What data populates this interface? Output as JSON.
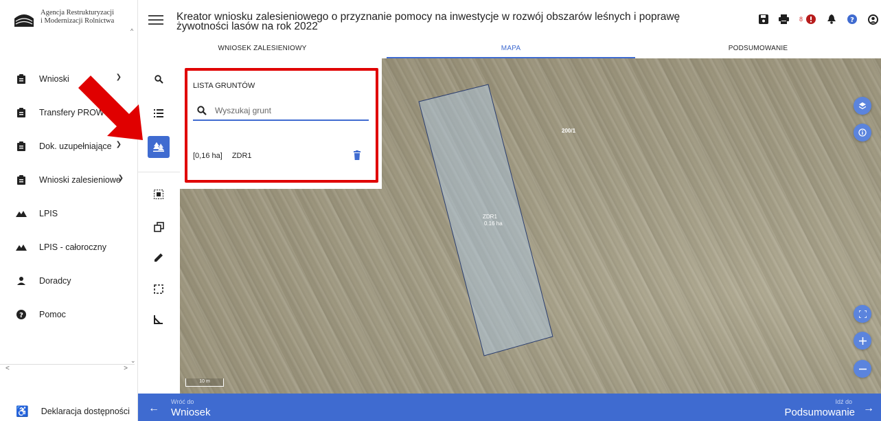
{
  "app": {
    "logo_line1": "Agencja Restrukturyzacji",
    "logo_line2": "i Modernizacji Rolnictwa",
    "logo_mark": "ARiMR"
  },
  "sidebar": {
    "items": [
      {
        "label": "Wnioski",
        "icon": "clipboard-icon",
        "has_chevron": true
      },
      {
        "label": "Transfery PROW",
        "icon": "clipboard-icon",
        "has_chevron": false
      },
      {
        "label": "Dok. uzupełniające",
        "icon": "clipboard-icon",
        "has_chevron": true
      },
      {
        "label": "Wnioski zalesieniowe",
        "icon": "clipboard-icon",
        "has_chevron": true
      },
      {
        "label": "LPIS",
        "icon": "landscape-icon",
        "has_chevron": false
      },
      {
        "label": "LPIS - całoroczny",
        "icon": "landscape-icon",
        "has_chevron": false
      },
      {
        "label": "Doradcy",
        "icon": "person-icon",
        "has_chevron": false
      },
      {
        "label": "Pomoc",
        "icon": "help-icon",
        "has_chevron": false
      }
    ],
    "accessibility_label": "Deklaracja dostępności"
  },
  "header": {
    "title": "Kreator wniosku zalesieniowego o przyznanie pomocy na inwestycje w rozwój obszarów leśnych i poprawę żywotności lasów na rok 2022",
    "notification_count": "8"
  },
  "tabs": [
    {
      "label": "WNIOSEK ZALESIENIOWY",
      "active": false
    },
    {
      "label": "MAPA",
      "active": true
    },
    {
      "label": "PODSUMOWANIE",
      "active": false
    }
  ],
  "panel": {
    "title": "LISTA GRUNTÓW",
    "search_placeholder": "Wyszukaj grunt",
    "plots": [
      {
        "area": "[0,16 ha]",
        "name": "ZDR1"
      }
    ]
  },
  "map": {
    "parcel_id": "200/1",
    "plot_name": "ZDR1",
    "plot_area": "0.16 ha",
    "scale": "10 m"
  },
  "footer": {
    "back_small": "Wróć do",
    "back_big": "Wniosek",
    "next_small": "Idź do",
    "next_big": "Podsumowanie"
  },
  "colors": {
    "accent": "#3f6bd0",
    "highlight": "#e00000",
    "footer": "#3f6bd0"
  }
}
